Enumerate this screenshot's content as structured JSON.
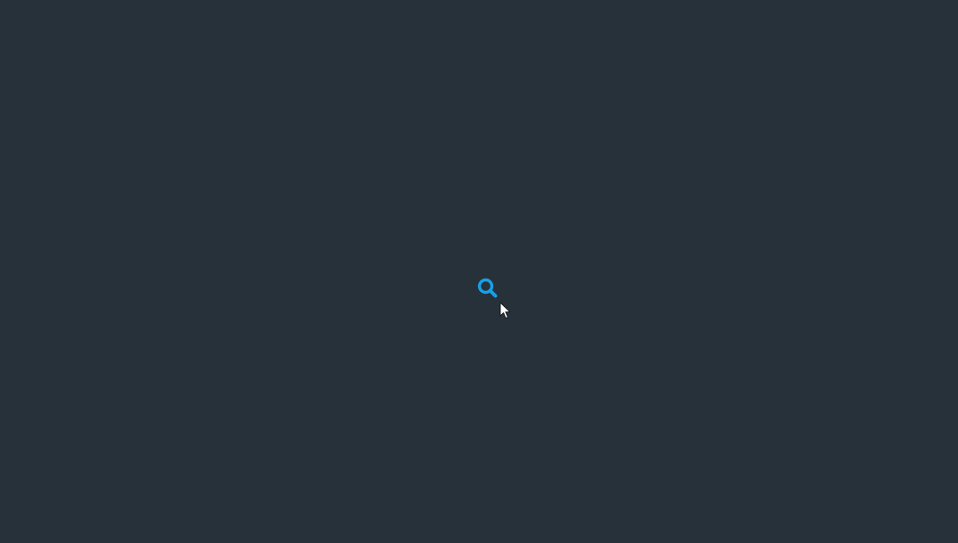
{
  "colors": {
    "background": "#26313a",
    "accent": "#17a0e8",
    "cursor_fill": "#ffffff",
    "cursor_outline": "#1a1a1a"
  },
  "icons": {
    "search": "search-icon",
    "cursor": "mouse-pointer-icon"
  }
}
